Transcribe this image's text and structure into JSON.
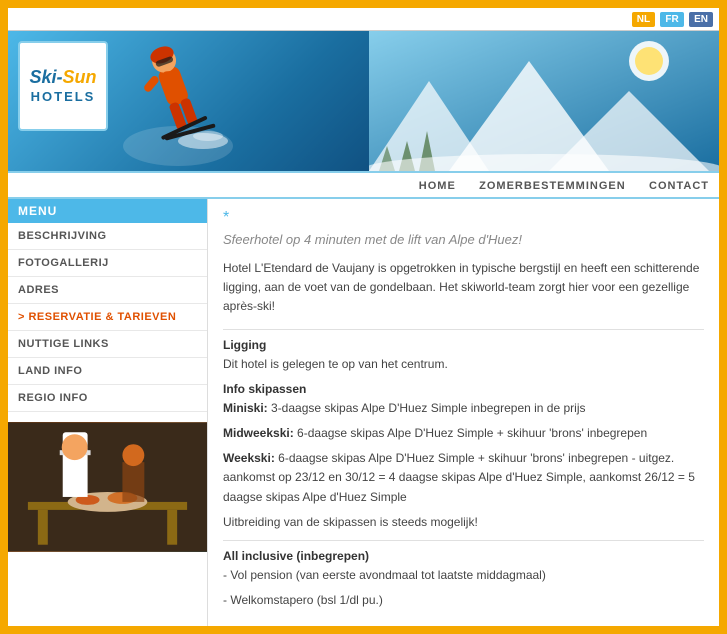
{
  "languages": {
    "nl": "NL",
    "fr": "FR",
    "en": "EN"
  },
  "logo": {
    "ski": "Ski-",
    "sun": "Sun",
    "hotels": "HOTELS"
  },
  "nav": {
    "home": "HOME",
    "zomerbestemmingen": "ZOMERBESTEMMINGEN",
    "contact": "CONTACT"
  },
  "sidebar": {
    "menu_header": "MENU",
    "items": [
      {
        "label": "BESCHRIJVING",
        "id": "beschrijving",
        "active": false
      },
      {
        "label": "FOTOGALLERIJ",
        "id": "fotogallerij",
        "active": false
      },
      {
        "label": "ADRES",
        "id": "adres",
        "active": false
      },
      {
        "label": "> RESERVATIE & TARIEVEN",
        "id": "reservatie",
        "active": true,
        "highlight": true
      },
      {
        "label": "NUTTIGE LINKS",
        "id": "links",
        "active": false
      },
      {
        "label": "LAND INFO",
        "id": "landinfo",
        "active": false
      },
      {
        "label": "REGIO INFO",
        "id": "regioinfo",
        "active": false
      }
    ]
  },
  "content": {
    "star": "*",
    "tagline": "Sfeerhotel op 4 minuten met de lift van Alpe d'Huez!",
    "intro": "Hotel L'Etendard de Vaujany is opgetrokken in typische bergstijl en heeft een schitterende ligging, aan de voet van de gondelbaan. Het skiworld-team zorgt hier voor een gezellige après-ski!",
    "sections": [
      {
        "title": "Ligging",
        "text": "Dit hotel is gelegen te op van het centrum."
      },
      {
        "title": "Info skipassen",
        "items": [
          {
            "label": "Miniski:",
            "text": "3-daagse skipas Alpe D'Huez Simple inbegrepen in de prijs"
          },
          {
            "label": "Midweekski:",
            "text": "6-daagse skipas Alpe D'Huez Simple + skihuur 'brons' inbegrepen"
          },
          {
            "label": "Weekski:",
            "text": "6-daagse skipas Alpe D'Huez Simple + skihuur 'brons' inbegrepen - uitgez. aankomst op 23/12 en 30/12 = 4 daagse skipas Alpe d'Huez Simple, aankomst 26/12 = 5 daagse skipas Alpe d'Huez Simple"
          }
        ]
      },
      {
        "title": "",
        "text": "Uitbreiding van de skipassen is steeds mogelijk!"
      },
      {
        "title": "All inclusive (inbegrepen)",
        "items": [
          {
            "text": "- Vol pension (van eerste avondmaal tot laatste middagmaal)"
          },
          {
            "text": "- Welkomstapero (bsl 1/dl pu.)"
          }
        ]
      }
    ]
  }
}
